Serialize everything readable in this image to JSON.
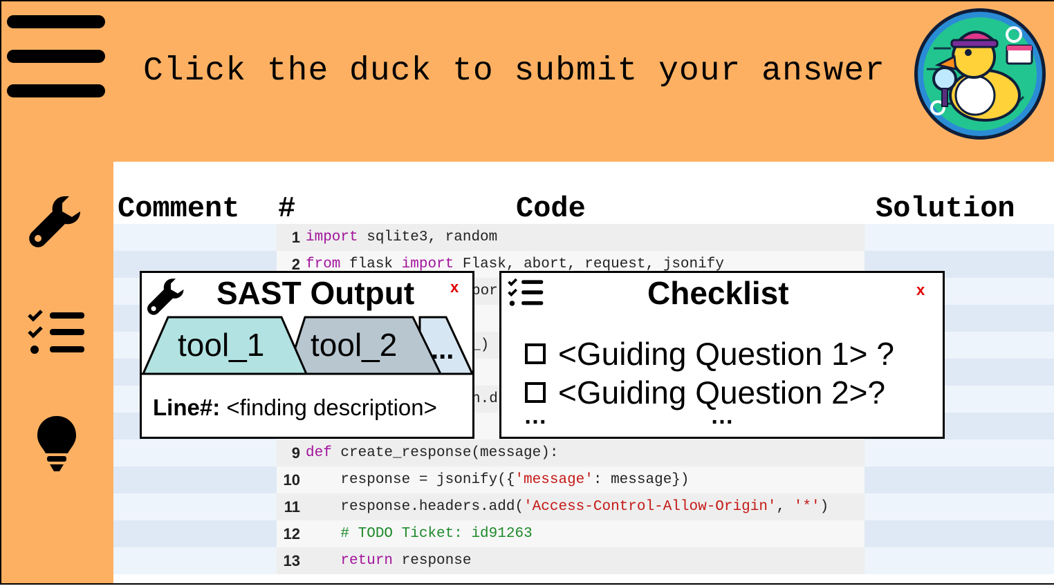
{
  "header": {
    "instruction": "Click the duck to submit your answer",
    "menu_icon": "hamburger-menu-icon",
    "submit_icon": "duck-detective-logo"
  },
  "sidebar": {
    "items": [
      {
        "icon": "wrench-icon"
      },
      {
        "icon": "checklist-icon"
      },
      {
        "icon": "lightbulb-icon"
      }
    ]
  },
  "table": {
    "headers": {
      "comment": "Comment",
      "line": "#",
      "code": "Code",
      "solution": "Solution"
    },
    "rows": [
      {
        "line": "1",
        "segments": [
          {
            "t": "import",
            "c": "kw"
          },
          {
            "t": " sqlite3, random",
            "c": ""
          }
        ]
      },
      {
        "line": "2",
        "segments": [
          {
            "t": "from",
            "c": "kw"
          },
          {
            "t": " flask ",
            "c": ""
          },
          {
            "t": "import",
            "c": "kw"
          },
          {
            "t": " Flask, abort, request, jsonify",
            "c": ""
          }
        ]
      },
      {
        "line": "9",
        "segments": [
          {
            "t": "def",
            "c": "kw"
          },
          {
            "t": " create_response(message):",
            "c": ""
          }
        ]
      },
      {
        "line": "10",
        "segments": [
          {
            "t": "    response = jsonify({",
            "c": ""
          },
          {
            "t": "'message'",
            "c": "str"
          },
          {
            "t": ": message})",
            "c": ""
          }
        ]
      },
      {
        "line": "11",
        "segments": [
          {
            "t": "    response.headers.add(",
            "c": ""
          },
          {
            "t": "'Access-Control-Allow-Origin'",
            "c": "str"
          },
          {
            "t": ", ",
            "c": ""
          },
          {
            "t": "'*'",
            "c": "str"
          },
          {
            "t": ")",
            "c": ""
          }
        ]
      },
      {
        "line": "12",
        "segments": [
          {
            "t": "    ",
            "c": ""
          },
          {
            "t": "# TODO Ticket: id91263",
            "c": "cmt"
          }
        ]
      },
      {
        "line": "13",
        "segments": [
          {
            "t": "    ",
            "c": ""
          },
          {
            "t": "return",
            "c": "kw"
          },
          {
            "t": " response",
            "c": ""
          }
        ]
      }
    ],
    "peek": {
      "row3": "por",
      "row6": "_)",
      "row8": "n.d"
    }
  },
  "sast_panel": {
    "title": "SAST Output",
    "close": "x",
    "tabs": [
      "tool_1",
      "tool_2",
      "..."
    ],
    "finding_label": "Line#:",
    "finding_text": "<finding description>"
  },
  "checklist_panel": {
    "title": "Checklist",
    "close": "x",
    "items": [
      "<Guiding Question 1> ?",
      "<Guiding Question 2>?"
    ],
    "more": "…"
  },
  "colors": {
    "background": "#fdb062",
    "stripe_light": "#eef4fb",
    "stripe_dark": "#dfe9f5",
    "code_row": "#eeeeee",
    "tab1": "#b2e2e2",
    "tab2": "#b8c6d0",
    "tab3": "#d6e6f2",
    "close": "#e00000"
  }
}
